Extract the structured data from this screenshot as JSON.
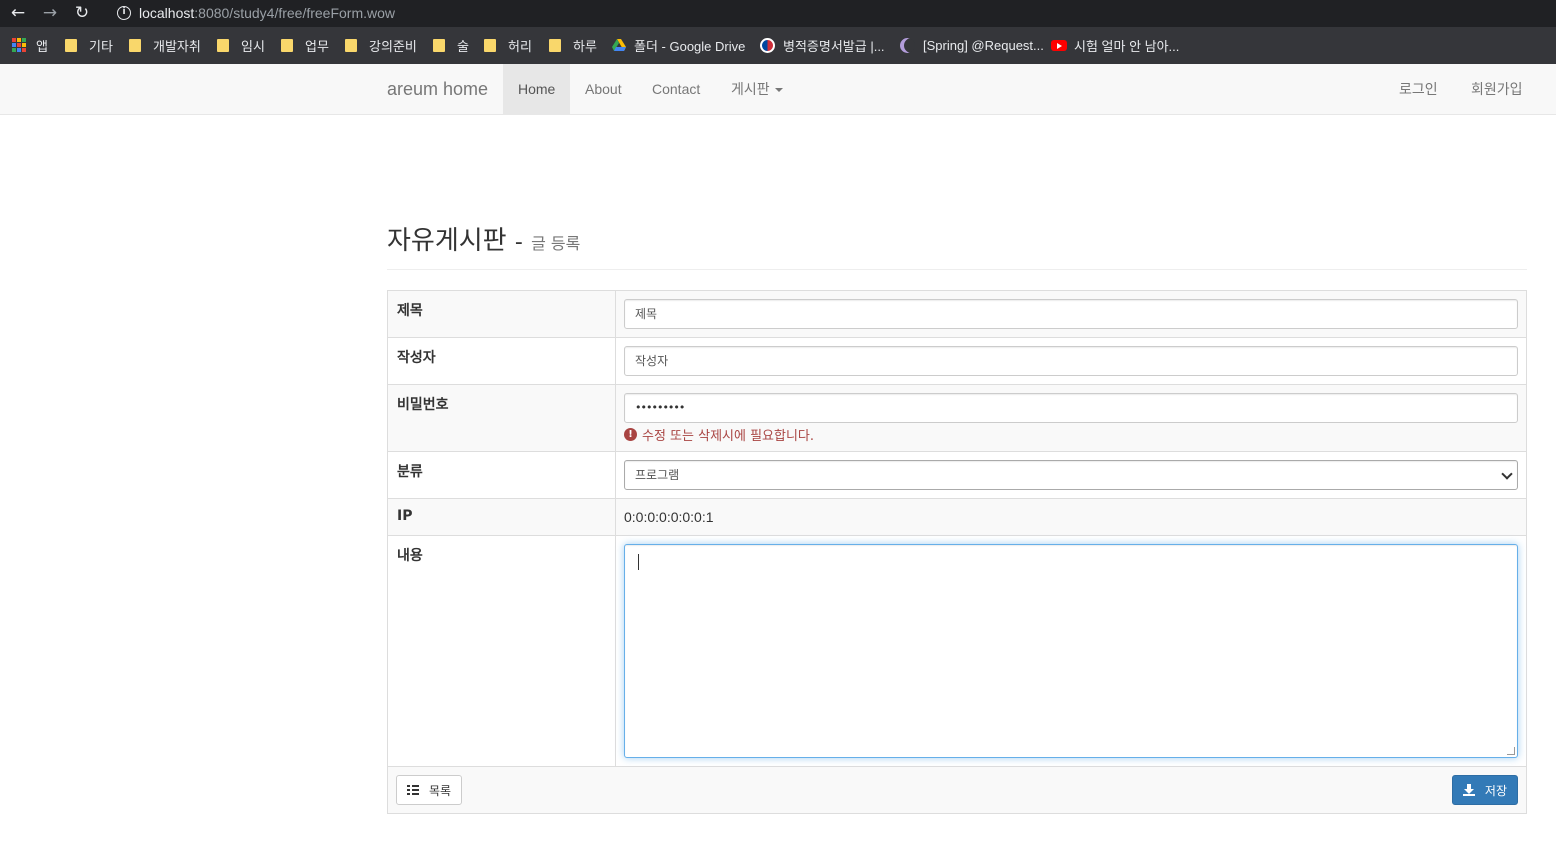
{
  "browser": {
    "url_host": "localhost",
    "url_path": ":8080/study4/free/freeForm.wow",
    "bookmarks": [
      {
        "label": "앱",
        "icon": "apps-grid-icon"
      },
      {
        "label": "기타",
        "icon": "folder-icon"
      },
      {
        "label": "개발자취",
        "icon": "folder-icon"
      },
      {
        "label": "임시",
        "icon": "folder-icon"
      },
      {
        "label": "업무",
        "icon": "folder-icon"
      },
      {
        "label": "강의준비",
        "icon": "folder-icon"
      },
      {
        "label": "술",
        "icon": "folder-icon"
      },
      {
        "label": "허리",
        "icon": "folder-icon"
      },
      {
        "label": "하루",
        "icon": "folder-icon"
      },
      {
        "label": "폴더 - Google Drive",
        "icon": "google-drive-icon"
      },
      {
        "label": "병적증명서발급 |...",
        "icon": "gov-emblem-icon"
      },
      {
        "label": "[Spring] @Request...",
        "icon": "moon-icon"
      },
      {
        "label": "시험 얼마 안 남아...",
        "icon": "youtube-icon"
      }
    ]
  },
  "navbar": {
    "brand": "areum home",
    "links": [
      {
        "label": "Home",
        "active": true
      },
      {
        "label": "About"
      },
      {
        "label": "Contact"
      },
      {
        "label": "게시판"
      }
    ],
    "right": {
      "login": "로그인",
      "signup": "회원가입"
    }
  },
  "page": {
    "title": "자유게시판",
    "dash": "-",
    "subtitle": "글 등록"
  },
  "form": {
    "title": {
      "label": "제목",
      "placeholder": "제목"
    },
    "writer": {
      "label": "작성자",
      "placeholder": "작성자"
    },
    "password": {
      "label": "비밀번호",
      "value": "•••••••••",
      "help": "수정 또는 삭제시에 필요합니다."
    },
    "category": {
      "label": "분류",
      "selected": "프로그램"
    },
    "ip": {
      "label": "IP",
      "value": "0:0:0:0:0:0:0:1"
    },
    "content": {
      "label": "내용",
      "value": ""
    },
    "buttons": {
      "list": "목록",
      "save": "저장"
    }
  },
  "colors": {
    "primary": "#337ab7",
    "error": "#a94442",
    "navbar_bg": "#f8f8f8"
  }
}
